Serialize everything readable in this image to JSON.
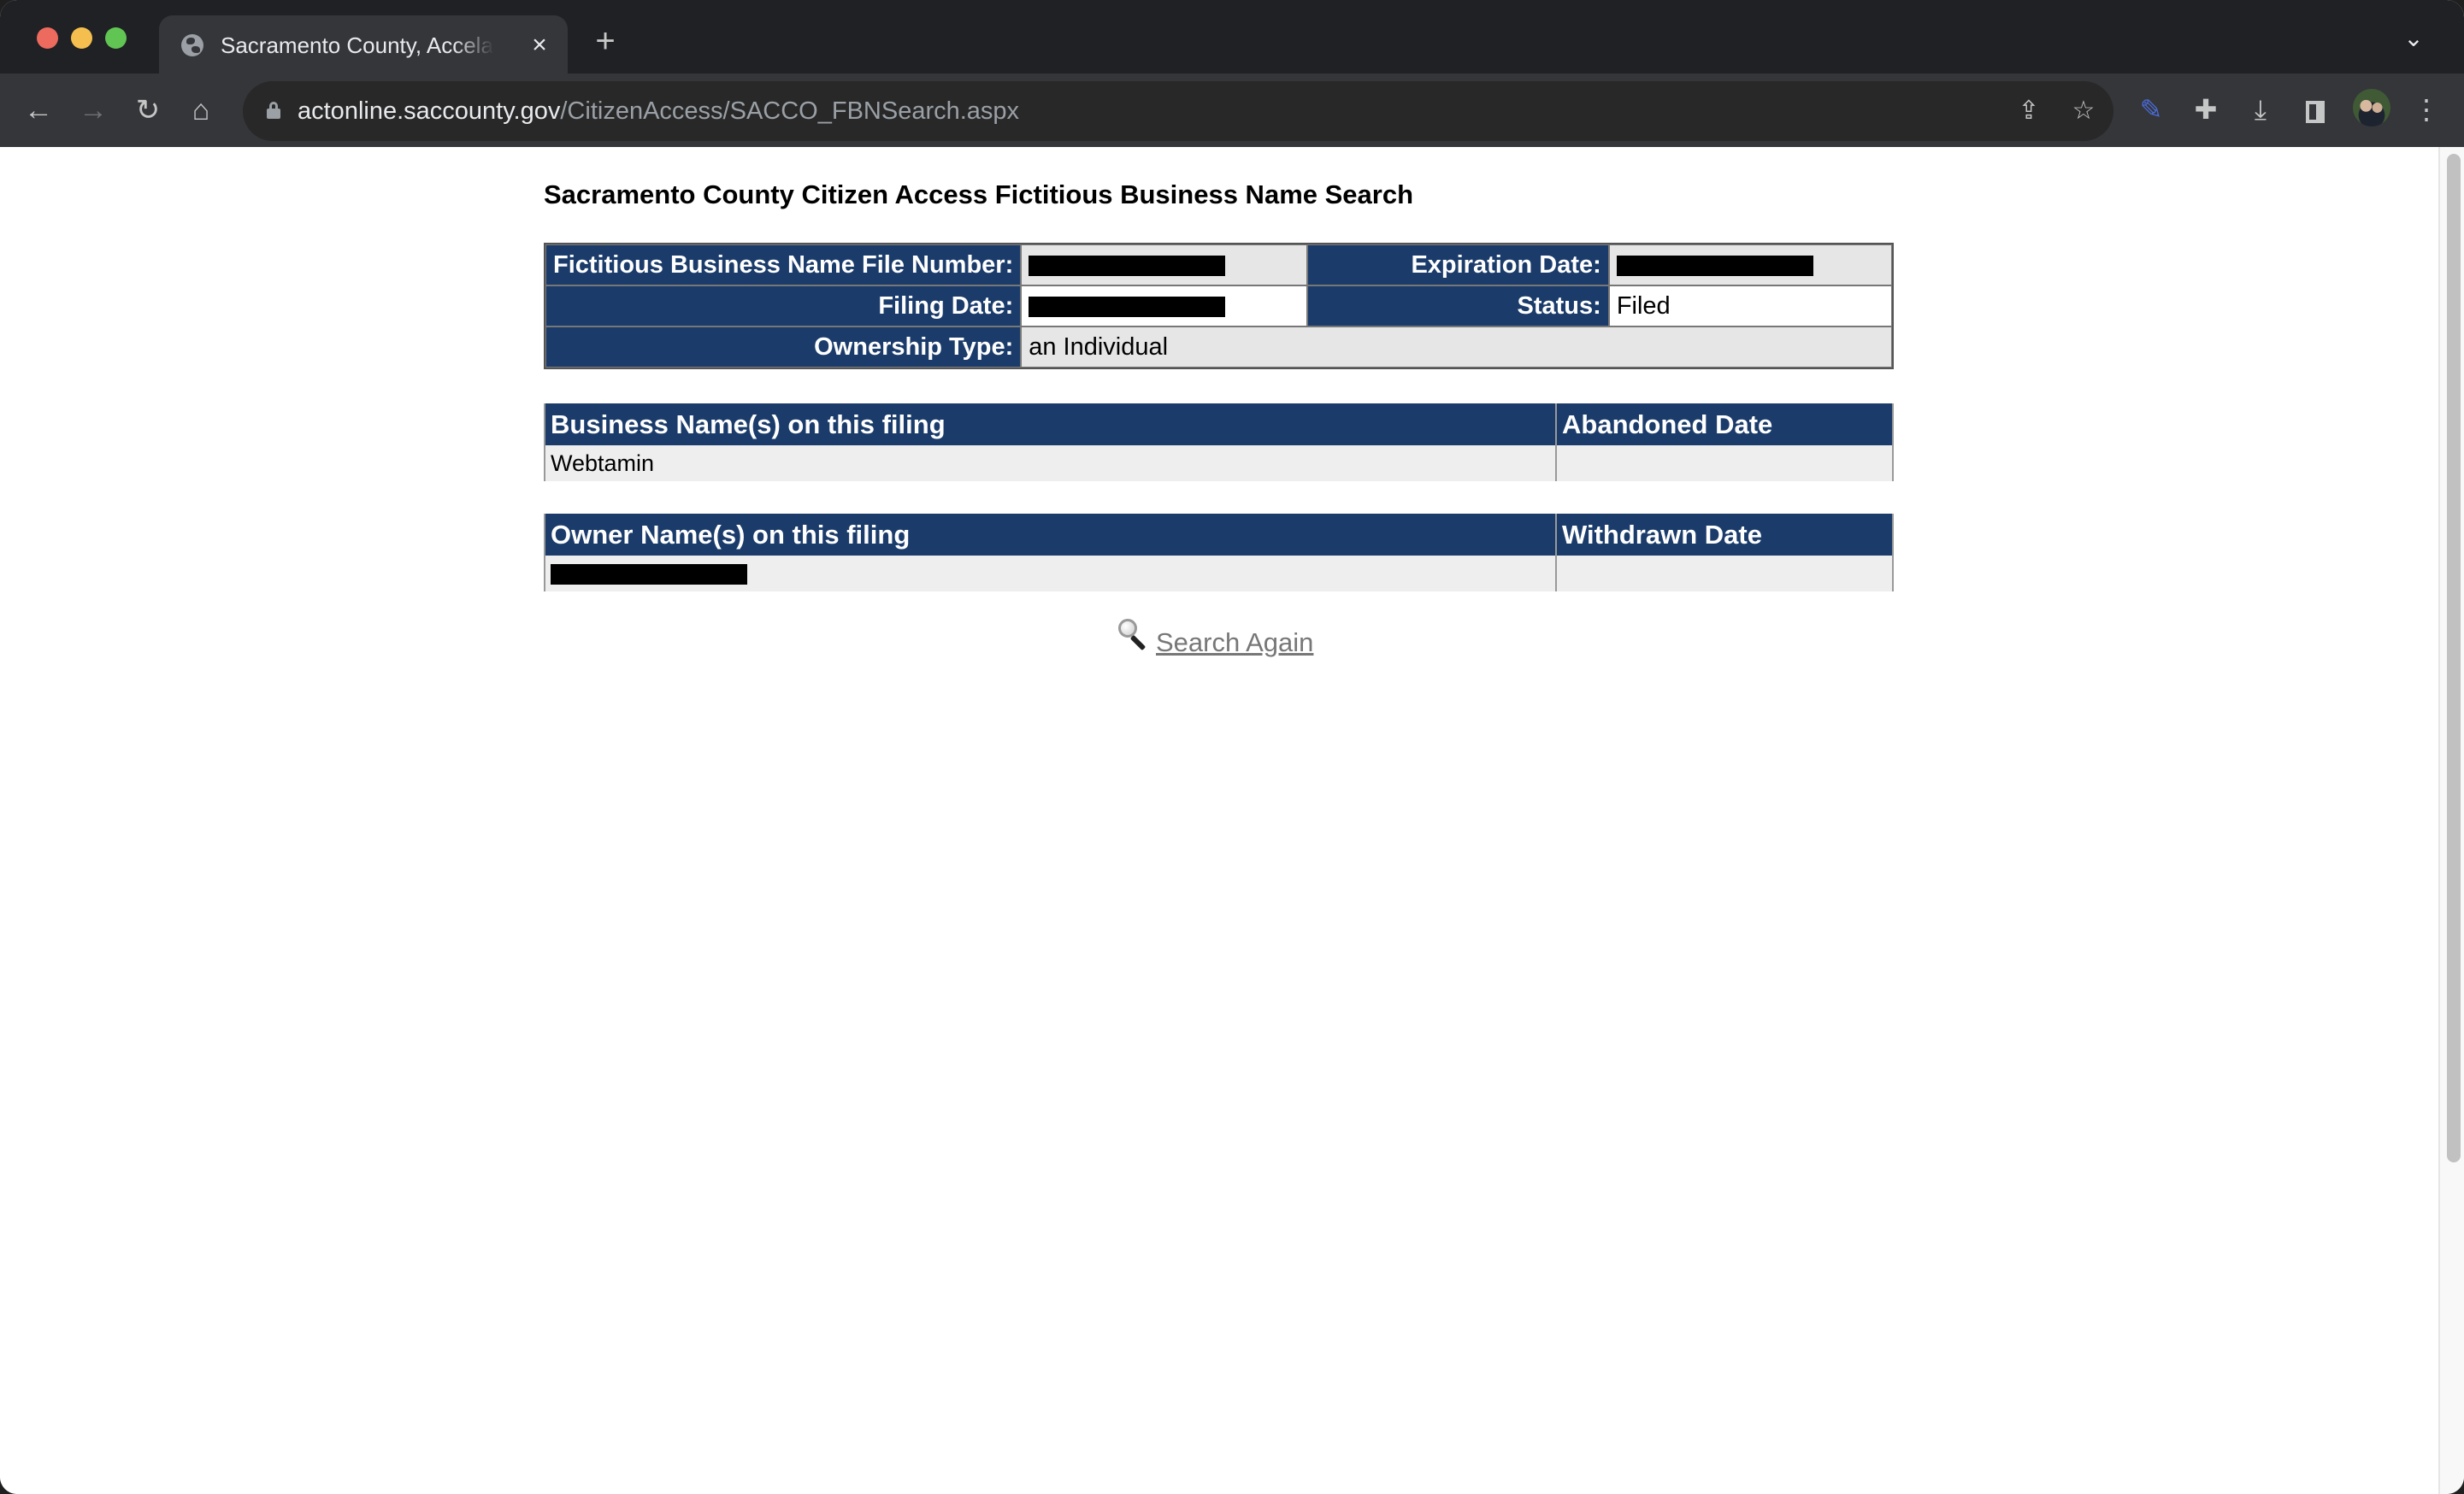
{
  "browser": {
    "tab_title": "Sacramento County, Accela Search",
    "tab_close": "×",
    "new_tab": "+",
    "tab_search": "⌄",
    "url_host": "actonline.saccounty.gov",
    "url_path": "/CitizenAccess/SACCO_FBNSearch.aspx",
    "icons": {
      "back": "←",
      "forward": "→",
      "reload": "↻",
      "home": "⌂",
      "share": "⇪",
      "star": "☆",
      "dropper": "✎",
      "puzzle": "✚",
      "download": "⤓",
      "menu": "⋮"
    }
  },
  "page": {
    "title": "Sacramento County Citizen Access Fictitious Business Name Search",
    "details": {
      "file_number_label": "Fictitious Business Name File Number:",
      "file_number_value": "[redacted]",
      "expiration_date_label": "Expiration Date:",
      "expiration_date_value": "[redacted]",
      "filing_date_label": "Filing Date:",
      "filing_date_value": "[redacted]",
      "status_label": "Status:",
      "status_value": "Filed",
      "ownership_type_label": "Ownership Type:",
      "ownership_type_value": "an Individual"
    },
    "business_names": {
      "headers": [
        "Business Name(s) on this filing",
        "Abandoned Date"
      ],
      "rows": [
        {
          "name": "Webtamin",
          "date": ""
        }
      ]
    },
    "owner_names": {
      "headers": [
        "Owner Name(s) on this filing",
        "Withdrawn Date"
      ],
      "rows": [
        {
          "name": "[redacted]",
          "date": ""
        }
      ]
    },
    "search_again_label": "Search Again"
  },
  "colors": {
    "header_bg": "#1b3c6b",
    "value_bg": "#e6e6e6",
    "link": "#777777"
  }
}
